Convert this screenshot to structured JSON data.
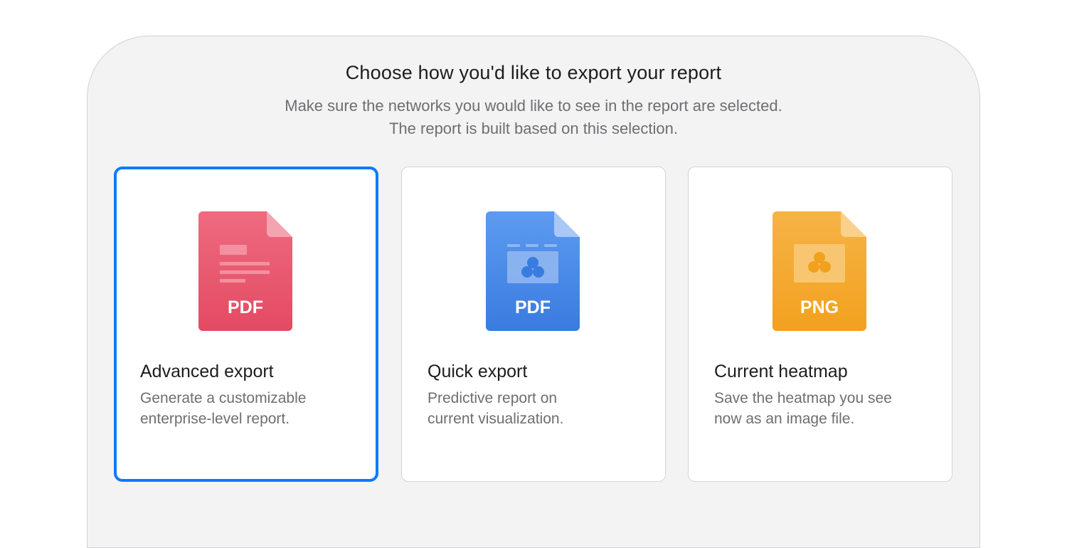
{
  "dialog": {
    "title": "Choose how you'd like to export your report",
    "subtitle_line1": "Make sure the networks you would like to see in the report are selected.",
    "subtitle_line2": "The report is built based on this selection."
  },
  "options": [
    {
      "name": "Advanced export",
      "desc_line1": "Generate a customizable",
      "desc_line2": "enterprise-level report.",
      "format": "PDF",
      "icon": "pdf-document-icon",
      "color": "#e8526a",
      "selected": true
    },
    {
      "name": "Quick export",
      "desc_line1": "Predictive report on",
      "desc_line2": "current visualization.",
      "format": "PDF",
      "icon": "pdf-visualization-icon",
      "color": "#3f84e6",
      "selected": false
    },
    {
      "name": "Current heatmap",
      "desc_line1": "Save the heatmap you see",
      "desc_line2": "now as an image file.",
      "format": "PNG",
      "icon": "png-image-icon",
      "color": "#f3a526",
      "selected": false
    }
  ],
  "colors": {
    "selection_border": "#0a7bff",
    "dialog_background": "#f3f3f3"
  }
}
